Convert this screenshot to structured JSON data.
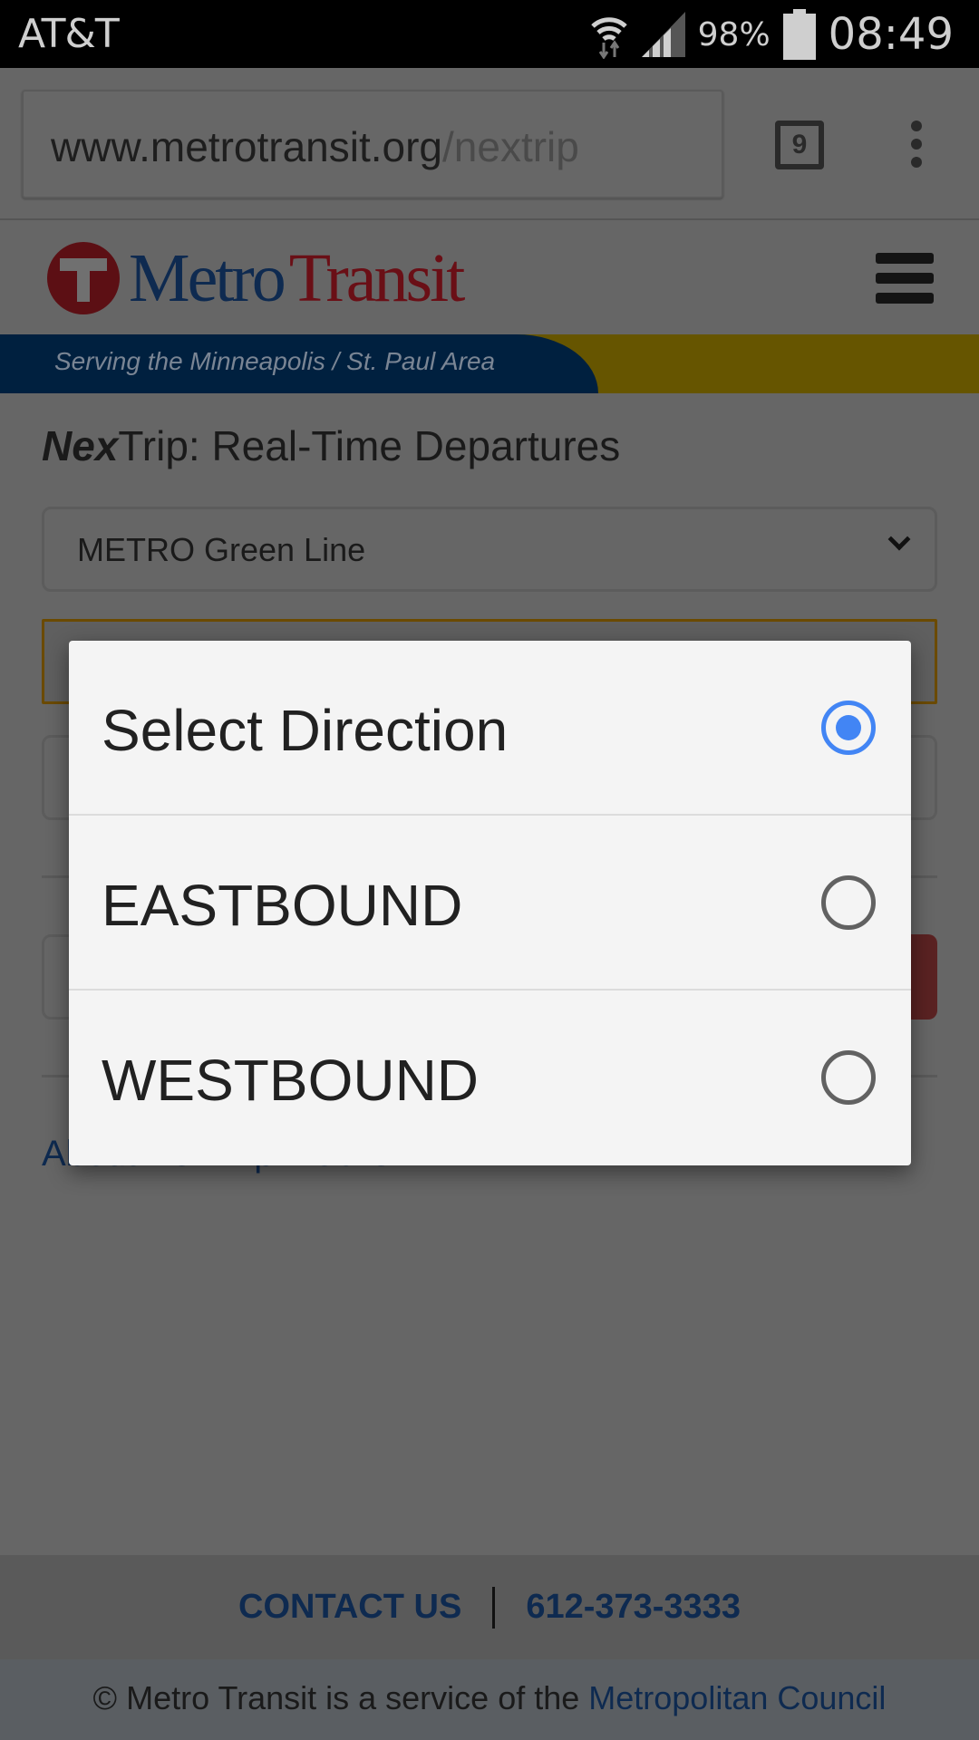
{
  "status_bar": {
    "carrier": "AT&T",
    "battery_percent": "98%",
    "time": "08:49",
    "icons": [
      "wifi-icon",
      "signal-icon",
      "battery-icon"
    ]
  },
  "browser": {
    "url_domain": "www.metrotransit.org",
    "url_path": "/nextrip",
    "tab_count": "9",
    "menu_icon": "more-vert-icon"
  },
  "site": {
    "logo_metro": "Metro",
    "logo_transit": "Transit",
    "tagline": "Serving the Minneapolis / St. Paul Area",
    "colors": {
      "brand_blue": "#003a70",
      "brand_red": "#c8102e",
      "banner_gold": "#ffd200"
    }
  },
  "main": {
    "title_bold": "Nex",
    "title_rest": "Trip: Real-Time Departures",
    "route_select_value": "METRO Green Line",
    "about_link_prefix": "About ",
    "about_link_bold": "Nex",
    "about_link_suffix": "Trip Mobile"
  },
  "footer": {
    "contact_label": "CONTACT US",
    "phone": "612-373-3333",
    "copyright_text": "© Metro Transit is a service of the ",
    "council_link": "Metropolitan Council"
  },
  "dialog": {
    "options": [
      {
        "label": "Select Direction",
        "selected": true
      },
      {
        "label": "EASTBOUND",
        "selected": false
      },
      {
        "label": "WESTBOUND",
        "selected": false
      }
    ],
    "accent_color": "#4285f4"
  }
}
